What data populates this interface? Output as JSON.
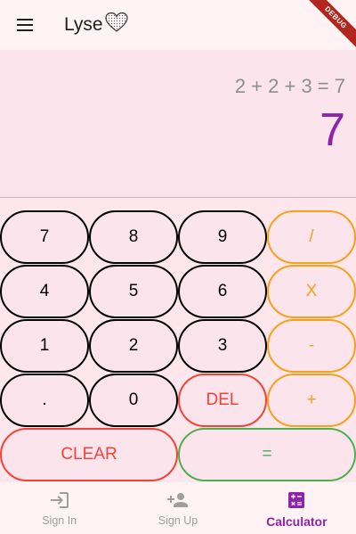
{
  "appbar": {
    "title": "Lyse",
    "menu_icon": "menu-icon",
    "heart_icon": "heart-icon"
  },
  "debug_banner": "DEBUG",
  "display": {
    "expression": "2 + 2 + 3 = 7",
    "result": "7"
  },
  "keys": {
    "k7": "7",
    "k8": "8",
    "k9": "9",
    "div": "/",
    "k4": "4",
    "k5": "5",
    "k6": "6",
    "mul": "X",
    "k1": "1",
    "k2": "2",
    "k3": "3",
    "sub": "-",
    "dot": ".",
    "k0": "0",
    "del": "DEL",
    "add": "+",
    "clear": "CLEAR",
    "equals": "="
  },
  "colors": {
    "accent": "#8e24aa",
    "operator": "#f9a01b",
    "danger": "#f44336",
    "success": "#4caf50"
  },
  "nav": [
    {
      "label": "Sign In",
      "icon": "login-icon",
      "active": false
    },
    {
      "label": "Sign Up",
      "icon": "person-add-icon",
      "active": false
    },
    {
      "label": "Calculator",
      "icon": "calculator-icon",
      "active": true
    }
  ]
}
